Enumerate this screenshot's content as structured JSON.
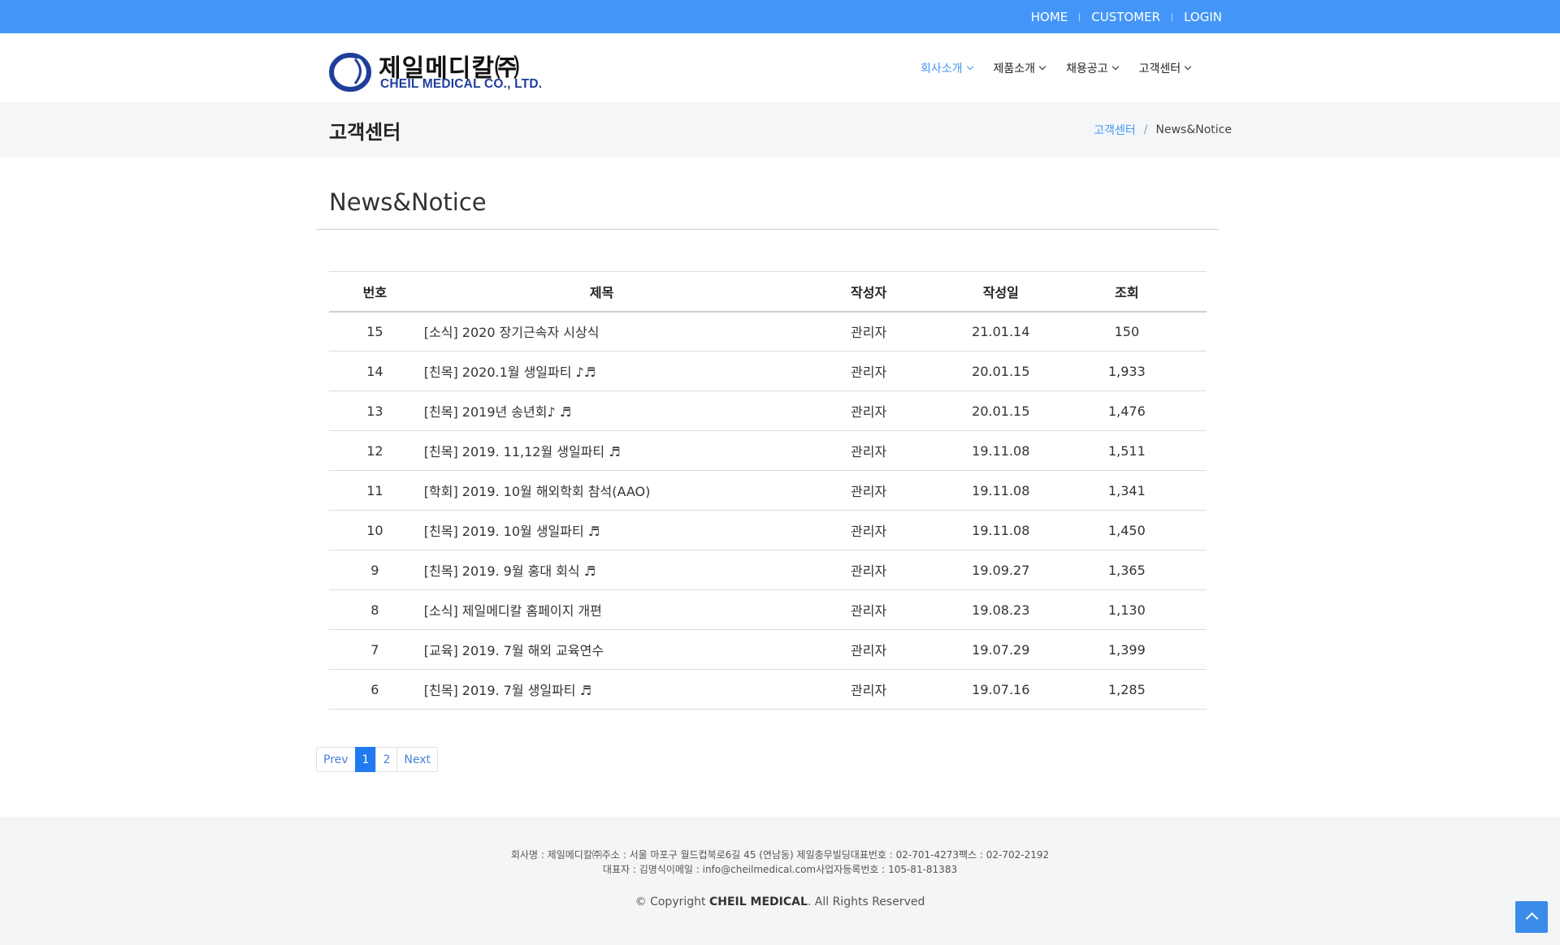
{
  "colors": {
    "topbar": "#4396f7",
    "accent": "#4396f7",
    "logo_blue": "#1f3e9c",
    "pagination_active": "#1f7bef",
    "footer_bg": "#f3f5f7"
  },
  "topbar": {
    "links": [
      "HOME",
      "CUSTOMER",
      "LOGIN"
    ]
  },
  "header": {
    "logo": {
      "icon": "cheil-circle-logo-icon",
      "korean": "제일메디칼㈜",
      "english": "CHEIL MEDICAL CO., LTD."
    },
    "nav": [
      {
        "label": "회사소개",
        "active": true
      },
      {
        "label": "제품소개",
        "active": false
      },
      {
        "label": "채용공고",
        "active": false
      },
      {
        "label": "고객센터",
        "active": false
      }
    ]
  },
  "titleband": {
    "heading": "고객센터",
    "breadcrumb": {
      "parent": "고객센터",
      "separator": "/",
      "current": "News&Notice"
    }
  },
  "section_title": "News&Notice",
  "table": {
    "headers": [
      "번호",
      "제목",
      "작성자",
      "작성일",
      "조회"
    ],
    "rows": [
      {
        "num": "15",
        "title": "[소식] 2020 장기근속자 시상식",
        "writer": "관리자",
        "date": "21.01.14",
        "views": "150"
      },
      {
        "num": "14",
        "title": "[친목] 2020.1월 생일파티 ♪♬",
        "writer": "관리자",
        "date": "20.01.15",
        "views": "1,933"
      },
      {
        "num": "13",
        "title": "[친목] 2019년 송년회♪ ♬",
        "writer": "관리자",
        "date": "20.01.15",
        "views": "1,476"
      },
      {
        "num": "12",
        "title": "[친목] 2019. 11,12월 생일파티 ♬",
        "writer": "관리자",
        "date": "19.11.08",
        "views": "1,511"
      },
      {
        "num": "11",
        "title": "[학회] 2019. 10월 해외학회 참석(AAO)",
        "writer": "관리자",
        "date": "19.11.08",
        "views": "1,341"
      },
      {
        "num": "10",
        "title": "[친목] 2019. 10월 생일파티 ♬",
        "writer": "관리자",
        "date": "19.11.08",
        "views": "1,450"
      },
      {
        "num": "9",
        "title": "[친목] 2019. 9월 홍대 회식 ♬",
        "writer": "관리자",
        "date": "19.09.27",
        "views": "1,365"
      },
      {
        "num": "8",
        "title": "[소식] 제일메디칼 홈페이지 개편",
        "writer": "관리자",
        "date": "19.08.23",
        "views": "1,130"
      },
      {
        "num": "7",
        "title": "[교육] 2019. 7월 해외 교육연수",
        "writer": "관리자",
        "date": "19.07.29",
        "views": "1,399"
      },
      {
        "num": "6",
        "title": "[친목] 2019. 7월 생일파티 ♬",
        "writer": "관리자",
        "date": "19.07.16",
        "views": "1,285"
      }
    ]
  },
  "pagination": {
    "prev": "Prev",
    "pages": [
      "1",
      "2"
    ],
    "current": "1",
    "next": "Next"
  },
  "footer": {
    "line1": "회사명 : 제일메디칼㈜주소 : 서울 마포구 월드컵북로6길 45 (연남동) 제일충무빌딩대표번호 : 02-701-4273팩스 : 02-702-2192",
    "line2": "대표자 : 김명식이메일 : info@cheilmedical.com사업자등록번호 : 105-81-81383",
    "copyright_prefix": "© Copyright ",
    "copyright_brand": "CHEIL MEDICAL",
    "copyright_suffix": ". All Rights Reserved"
  },
  "back_to_top_icon": "arrow-up-icon"
}
